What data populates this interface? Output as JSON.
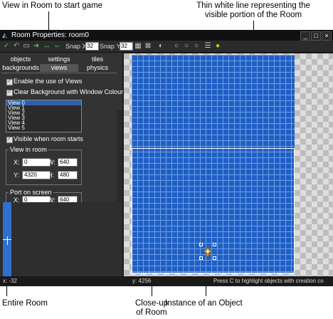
{
  "callouts": {
    "top_left": "View in Room to start game",
    "top_right_line1": "Thin white line representing the",
    "top_right_line2": "visible portion of the Room",
    "bottom_entire_room": "Entire Room",
    "bottom_closeup_line1": "Close-up",
    "bottom_closeup_line2": "of Room",
    "bottom_instance": "Instance of an Object"
  },
  "window": {
    "title": "Room Properties: room0",
    "controls": [
      "_",
      "□",
      "×"
    ]
  },
  "toolbar": {
    "snap_x_label": "Snap X",
    "snap_x_value": "32",
    "snap_y_label": "Snap Y",
    "snap_y_value": "32",
    "icons": [
      "check-icon",
      "undo-icon",
      "new-icon",
      "open-icon",
      "save-icon",
      "shift-icon",
      "grid-icon",
      "iso-grid-icon",
      "zoom-out-icon",
      "zoom-in-icon",
      "zoom-reset-icon",
      "list-icon",
      "delete-icon"
    ]
  },
  "tabs": {
    "row1": [
      "objects",
      "settings",
      "tiles"
    ],
    "row2": [
      "backgrounds",
      "views",
      "physics"
    ],
    "active": "views"
  },
  "views_panel": {
    "enable_views": "Enable the use of Views",
    "clear_background": "Clear Background with Window Colour",
    "view_list": [
      "View 0",
      "View 1",
      "View 2",
      "View 3",
      "View 4",
      "View 5"
    ],
    "visible_when_starts": "Visible when room starts",
    "view_in_room": {
      "legend": "View in room",
      "x_label": "X:",
      "x_value": "0",
      "w_label": "W:",
      "w_value": "640",
      "y_label": "Y:",
      "y_value": "4320",
      "h_label": "H:",
      "h_value": "480"
    },
    "port_on_screen": {
      "legend": "Port on screen",
      "x_label": "X:",
      "x_value": "0",
      "w_label": "W:",
      "w_value": "640"
    }
  },
  "statusbar": {
    "x": "x: -32",
    "y": "y: 4256",
    "hint": "Press C to highlight objects with creation co"
  },
  "colors": {
    "room_blue": "#1f5fc4",
    "grid_line": "#6ea0e6",
    "panel_bg": "#333333"
  }
}
